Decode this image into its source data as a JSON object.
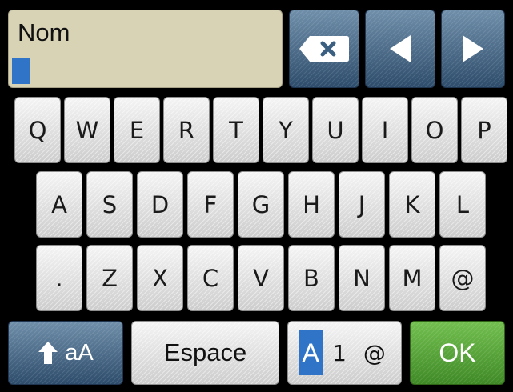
{
  "input": {
    "value": "Nom"
  },
  "icons": {
    "backspace": "backspace-icon",
    "left": "left-arrow-icon",
    "right": "right-arrow-icon",
    "shift": "shift-arrow-icon"
  },
  "keyboard": {
    "row1": [
      "Q",
      "W",
      "E",
      "R",
      "T",
      "Y",
      "U",
      "I",
      "O",
      "P"
    ],
    "row2": [
      "A",
      "S",
      "D",
      "F",
      "G",
      "H",
      "J",
      "K",
      "L"
    ],
    "row3": [
      ".",
      "Z",
      "X",
      "C",
      "V",
      "B",
      "N",
      "M",
      "@"
    ]
  },
  "bottom": {
    "shift_label": "aA",
    "space_label": "Espace",
    "mode_active": "A",
    "mode_rest": "1 @",
    "ok_label": "OK"
  },
  "colors": {
    "accent_blue": "#2f74c6",
    "ok_green": "#53a33a",
    "field_bg": "#d9d3b6"
  }
}
